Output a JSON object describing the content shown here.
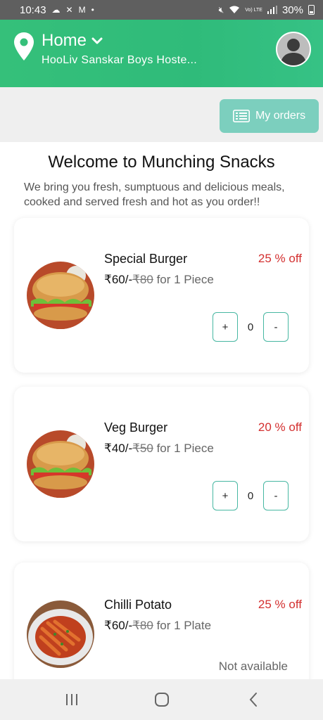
{
  "status_bar": {
    "time": "10:43",
    "left_icons": [
      "cloud-icon",
      "x-icon",
      "gmail-icon",
      "dot-icon"
    ],
    "battery_text": "30%",
    "network_label": "Vo) LTE"
  },
  "header": {
    "location_title": "Home",
    "location_subtitle": "HooLiv Sanskar Boys Hoste..."
  },
  "orders_button": {
    "label": "My orders",
    "icon": "list-icon"
  },
  "welcome": {
    "title": "Welcome to Munching Snacks",
    "tagline": "We bring you fresh, sumptuous and delicious meals, cooked and served fresh and hot as you order!!"
  },
  "items": [
    {
      "name": "Special Burger",
      "discount": "25 % off",
      "price_now": "₹60/-",
      "price_old": "₹80",
      "unit": " for 1 Piece",
      "quantity": "0",
      "plus": "+",
      "minus": "-"
    },
    {
      "name": "Veg Burger",
      "discount": "20 % off",
      "price_now": "₹40/-",
      "price_old": "₹50",
      "unit": " for 1 Piece",
      "quantity": "0",
      "plus": "+",
      "minus": "-"
    },
    {
      "name": "Chilli Potato",
      "discount": "25 % off",
      "price_now": "₹60/-",
      "price_old": "₹80",
      "unit": " for 1 Plate",
      "availability": "Not available"
    }
  ],
  "colors": {
    "header": "#35c07a",
    "accent": "#7ccfbe",
    "discount": "#d32f2f",
    "stepper_border": "#47b7a2"
  }
}
